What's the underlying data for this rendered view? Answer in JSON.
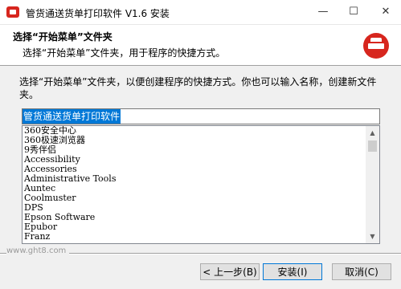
{
  "window": {
    "title": "管货通送货单打印软件 V1.6 安装",
    "minimize_glyph": "—",
    "maximize_glyph": "☐",
    "close_glyph": "✕",
    "brand_color": "#d7261e"
  },
  "header": {
    "title": "选择“开始菜单”文件夹",
    "subtitle": "选择“开始菜单”文件夹，用于程序的快捷方式。"
  },
  "body": {
    "description": "选择“开始菜单”文件夹，以便创建程序的快捷方式。你也可以输入名称，创建新文件夹。",
    "folder_value": "管货通送货单打印软件",
    "folders": [
      "360安全中心",
      "360极速浏览器",
      "9秀伴侣",
      "Accessibility",
      "Accessories",
      "Administrative Tools",
      "Auntec",
      "Coolmuster",
      "DPS",
      "Epson Software",
      "Epubor",
      "Franz"
    ]
  },
  "scrollbar": {
    "up_glyph": "▲",
    "down_glyph": "▼"
  },
  "footer": {
    "site": "www.ght8.com",
    "back_label": "< 上一步(B)",
    "install_label": "安装(I)",
    "cancel_label": "取消(C)"
  }
}
